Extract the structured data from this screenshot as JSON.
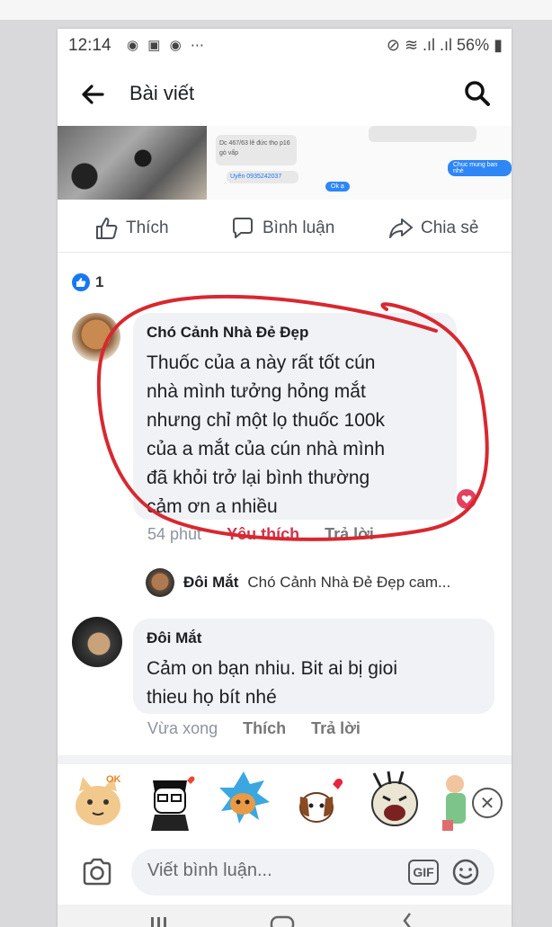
{
  "status_bar": {
    "time": "12:14",
    "battery": "56%"
  },
  "app_bar": {
    "title": "Bài viết"
  },
  "post_image": {
    "chat_lines": [
      "Dc 467/63 lê đức thọ p16",
      "gò vấp",
      "Uyên 0935242037",
      "Chuc mung ban nhé",
      "Ok ạ"
    ]
  },
  "actions": {
    "like": "Thích",
    "comment": "Bình luận",
    "share": "Chia sẻ"
  },
  "reactions": {
    "count": "1"
  },
  "comments": [
    {
      "author": "Chó Cảnh Nhà Đẻ Đẹp",
      "lines": [
        "Thuốc của a này rất tốt cún",
        "nhà mình tưởng hỏng mắt",
        "nhưng chỉ một lọ thuốc 100k",
        "của a mắt của cún nhà mình",
        "đã khỏi trở lại bình thường",
        "cảm ơn a nhiều"
      ],
      "time": "54 phút",
      "like_action": "Yêu thích",
      "reply_action": "Trả lời"
    },
    {
      "author": "Đôi Mắt",
      "lines": [
        "Cảm on bạn nhiu. Bit ai bị gioi",
        "thieu họ bít nhé"
      ],
      "time": "Vừa xong",
      "like_action": "Thích",
      "reply_action": "Trả lời"
    }
  ],
  "reply_preview": {
    "author": "Đôi Mắt",
    "text": "Chó Cảnh Nhà Đẻ Đẹp cam..."
  },
  "composer": {
    "placeholder": "Viết bình luận...",
    "gif": "GIF"
  },
  "colors": {
    "accent": "#1877f2",
    "liked": "#d1344b",
    "annotation": "#d8282f"
  }
}
